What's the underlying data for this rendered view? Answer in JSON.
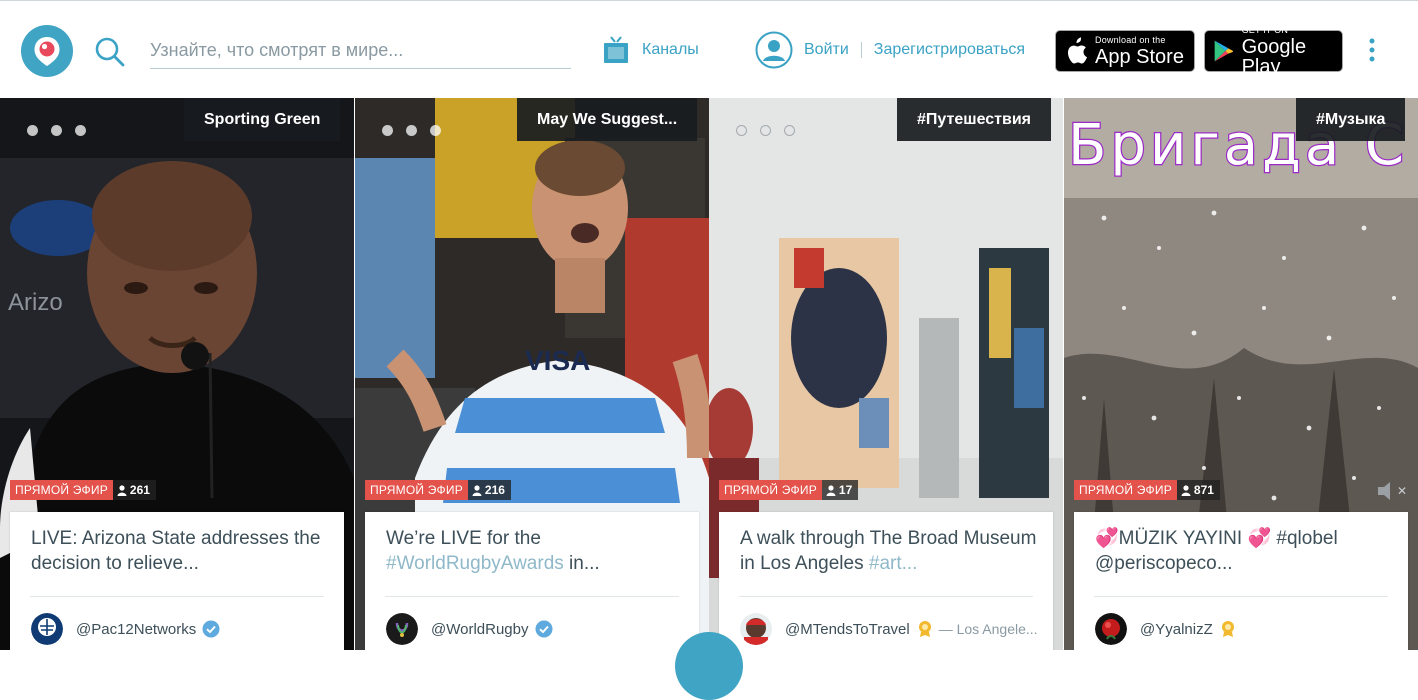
{
  "header": {
    "search": {
      "placeholder": "Узнайте, что смотрят в мире..."
    },
    "channels_label": "Каналы",
    "login_label": "Войти",
    "register_label": "Зарегистрироваться",
    "appstore": {
      "small": "Download on the",
      "big": "App Store"
    },
    "googleplay": {
      "small": "GET IT ON",
      "big": "Google Play"
    }
  },
  "colors": {
    "accent": "#40a4c4",
    "live": "#e3534b",
    "text": "#3d4f58"
  },
  "cards": [
    {
      "channel": "Sporting Green",
      "live_label": "ПРЯМОЙ ЭФИР",
      "viewers": "261",
      "title_pre": "LIVE: Arizona State addresses the decision to relieve...",
      "title_tag": "",
      "title_post": "",
      "username": "@Pac12Networks",
      "badge": "verified",
      "location": ""
    },
    {
      "channel": "May We Suggest...",
      "live_label": "ПРЯМОЙ ЭФИР",
      "viewers": "216",
      "title_pre": "We’re LIVE for the ",
      "title_tag": "#WorldRugbyAwards",
      "title_post": " in...",
      "username": "@WorldRugby",
      "badge": "verified",
      "location": ""
    },
    {
      "channel": "#Путешествия",
      "live_label": "ПРЯМОЙ ЭФИР",
      "viewers": "17",
      "title_pre": "A walk through The Broad Museum in Los Angeles ",
      "title_tag": "#art...",
      "title_post": "",
      "username": "@MTendsToTravel",
      "badge": "superfan",
      "location": "— Los Angele..."
    },
    {
      "channel": "#Музыка",
      "live_label": "ПРЯМОЙ ЭФИР",
      "viewers": "871",
      "title_pre": "💞MÜZIK YAYINI 💞 #qlobel @periscopeco...",
      "title_tag": "",
      "title_post": "",
      "username": "@YyalnizZ",
      "badge": "superfan",
      "location": ""
    }
  ],
  "card4_overlay_text": "Бригада С"
}
